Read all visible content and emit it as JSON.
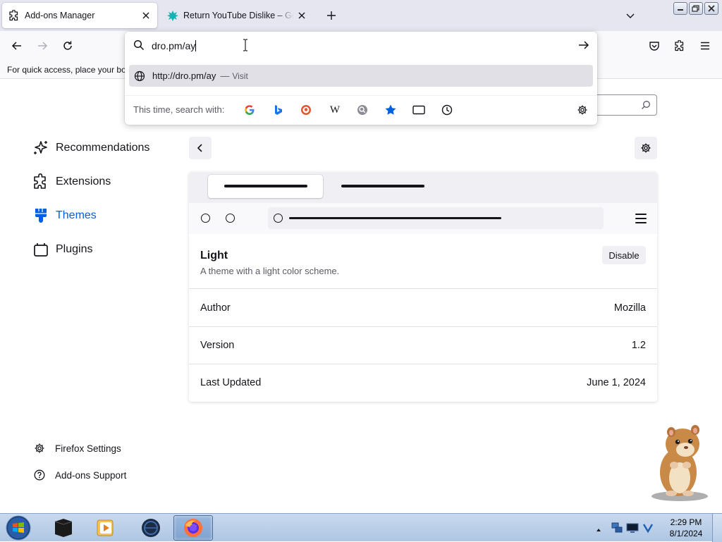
{
  "tabs": [
    {
      "title": "Add-ons Manager",
      "icon": "puzzle-icon",
      "active": true
    },
    {
      "title": "Return YouTube Dislike – Get th",
      "icon": "ryd-logo-icon",
      "active": false
    }
  ],
  "urlbar": {
    "value": "dro.pm/ay",
    "suggestion": {
      "url": "http://dro.pm/ay",
      "separator": "—",
      "action": "Visit"
    },
    "oneoff_label": "This time, search with:",
    "engines": [
      "Google",
      "Bing",
      "DuckDuckGo",
      "Wikipedia",
      "Ecosia",
      "Bookmarks",
      "Tabs",
      "History"
    ]
  },
  "bookmarks_bar": {
    "text": "For quick access, place your bookmarks here on the bookmarks toolbar."
  },
  "sidebar": {
    "items": [
      {
        "label": "Recommendations",
        "icon": "sparkle-icon",
        "selected": false
      },
      {
        "label": "Extensions",
        "icon": "puzzle-icon",
        "selected": false
      },
      {
        "label": "Themes",
        "icon": "brush-icon",
        "selected": true
      },
      {
        "label": "Plugins",
        "icon": "plugin-icon",
        "selected": false
      }
    ],
    "footer": [
      {
        "label": "Firefox Settings",
        "icon": "gear-icon"
      },
      {
        "label": "Add-ons Support",
        "icon": "help-icon"
      }
    ]
  },
  "theme": {
    "name": "Light",
    "description": "A theme with a light color scheme.",
    "disable_label": "Disable",
    "details": [
      {
        "key": "Author",
        "value": "Mozilla"
      },
      {
        "key": "Version",
        "value": "1.2"
      },
      {
        "key": "Last Updated",
        "value": "June 1, 2024"
      }
    ]
  },
  "taskbar": {
    "time": "2:29 PM",
    "date": "8/1/2024"
  },
  "colors": {
    "accent": "#0061e0",
    "tabstrip": "#e6e6f1"
  }
}
